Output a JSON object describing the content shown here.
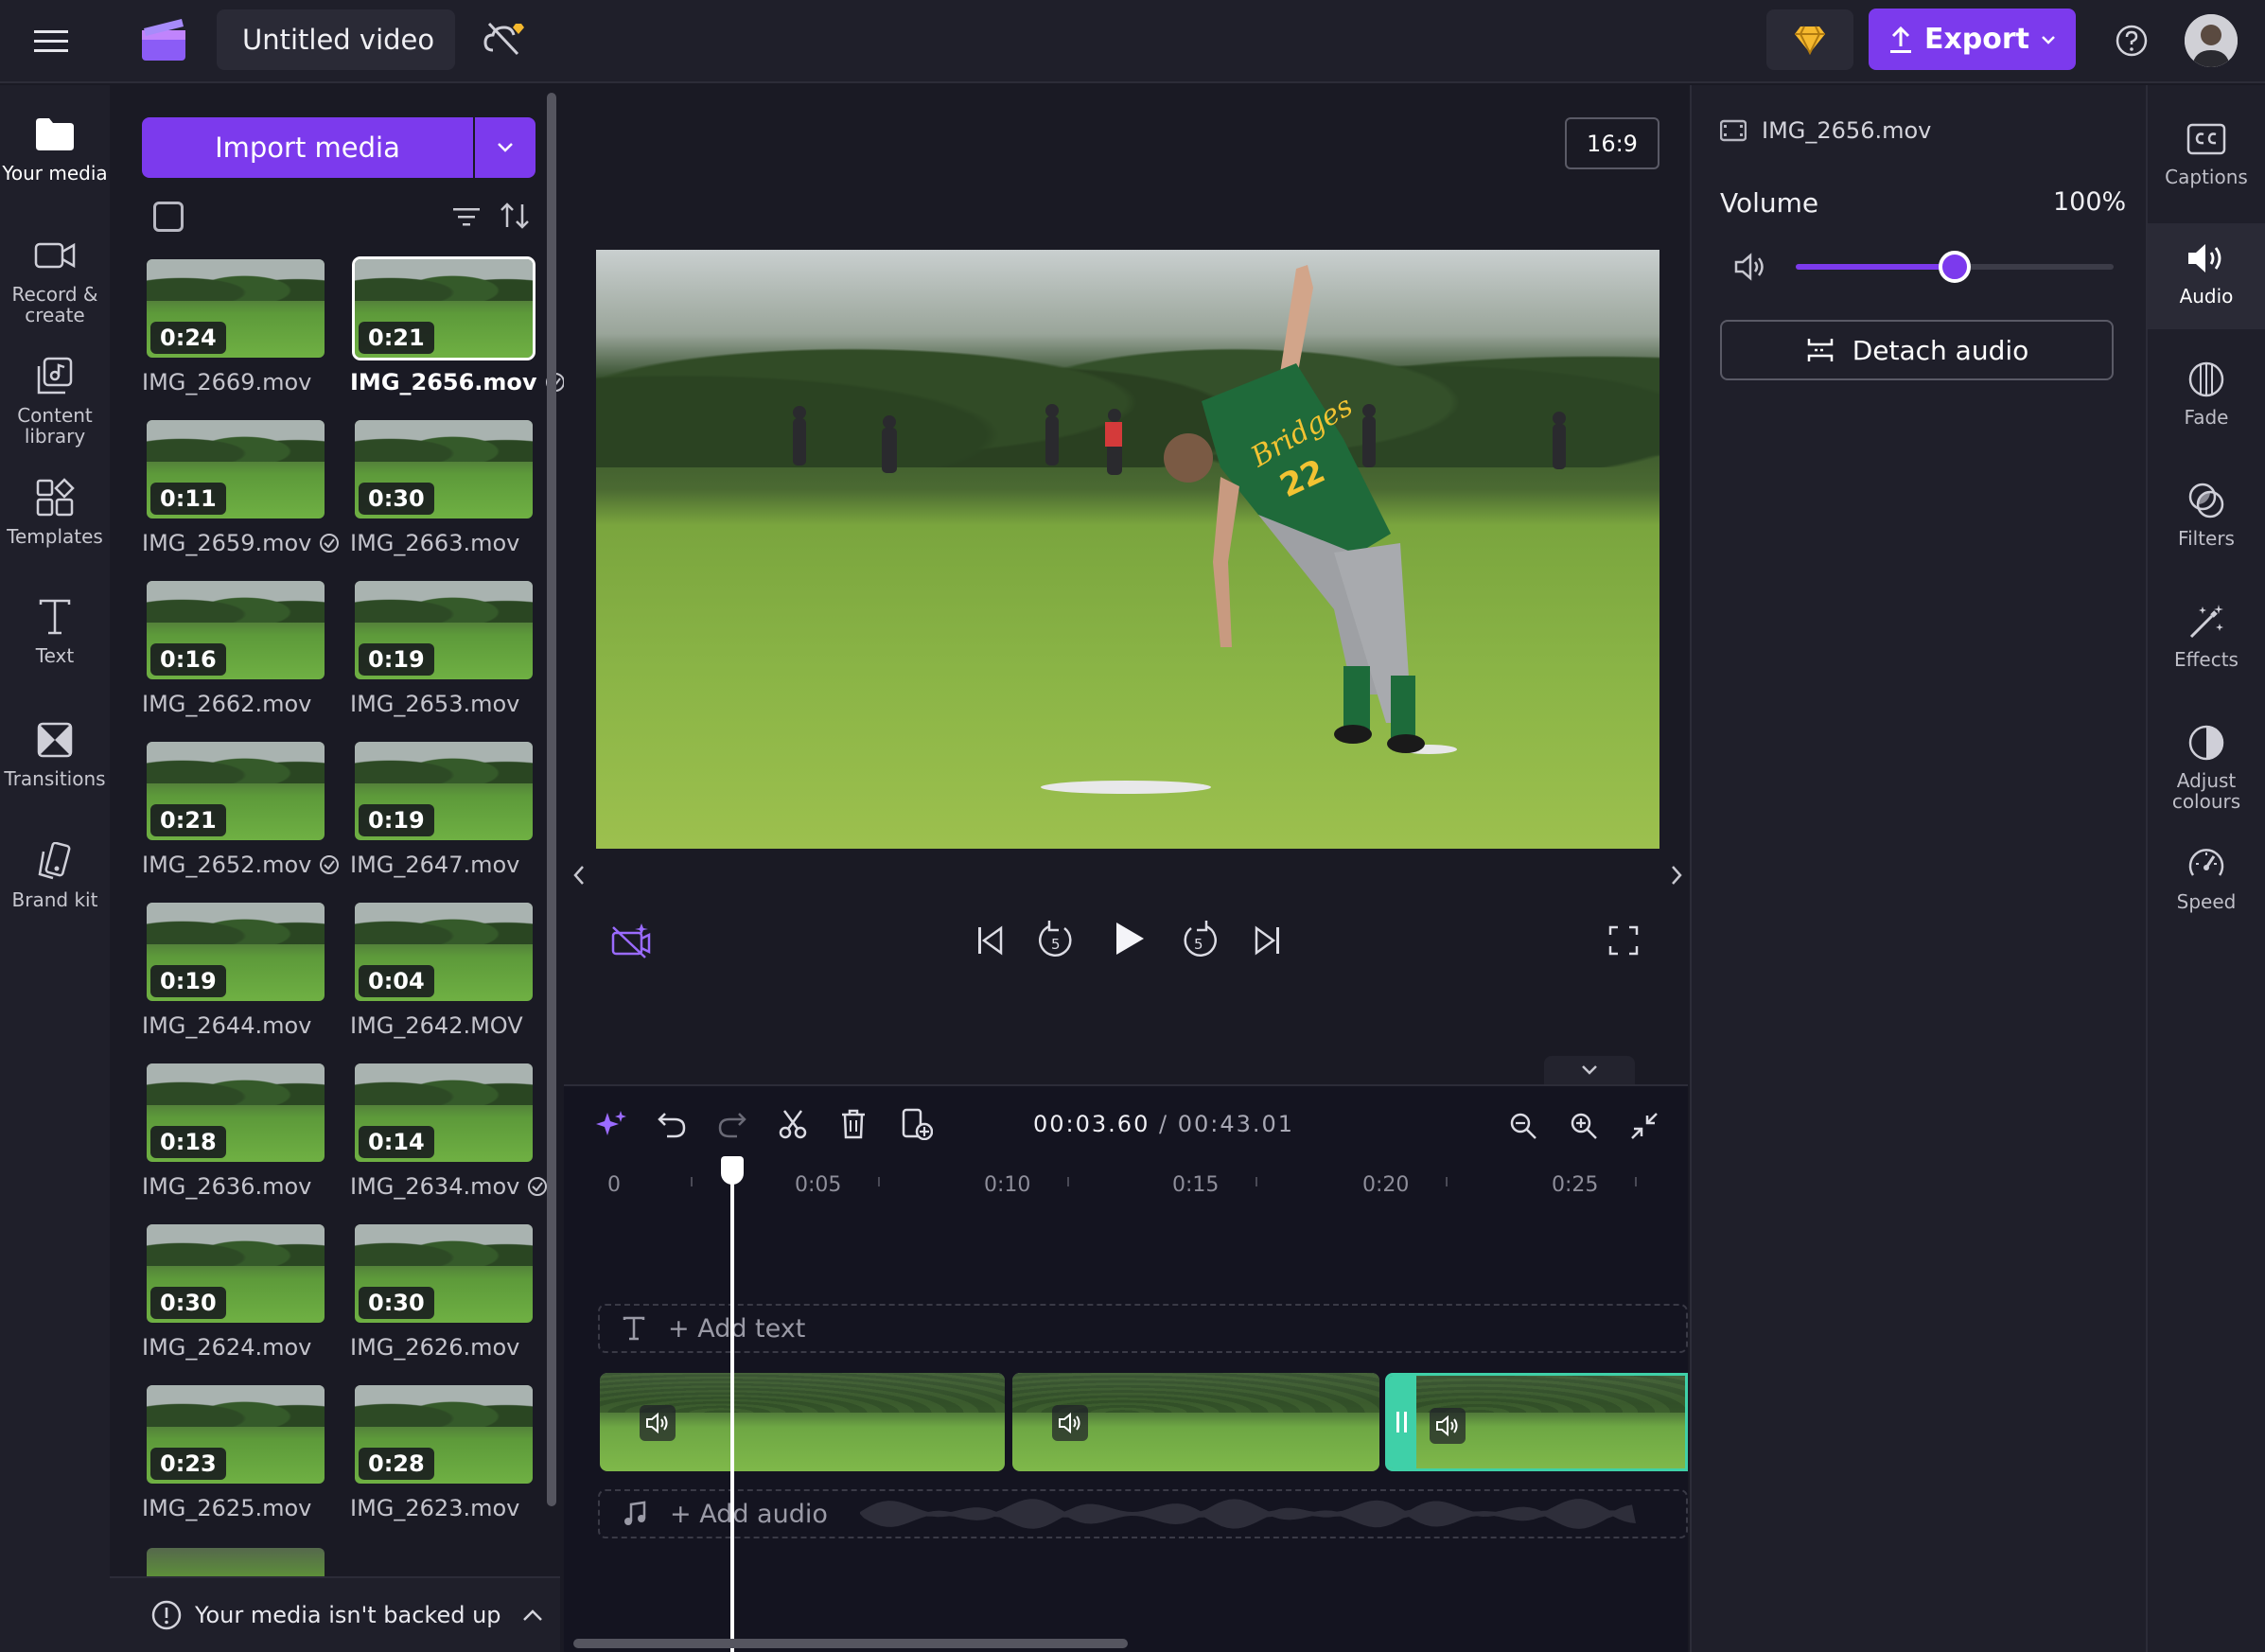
{
  "header": {
    "menu_icon": "hamburger-menu-icon",
    "logo": "clipchamp-logo",
    "project_title": "Untitled video",
    "sync_icon": "cloud-off-premium-icon",
    "premium_icon": "diamond-icon",
    "export_label": "Export",
    "help_icon": "help-icon"
  },
  "left_nav": [
    {
      "label": "Your media",
      "icon": "folder-icon",
      "active": true
    },
    {
      "label": "Record & create",
      "icon": "camera-icon"
    },
    {
      "label": "Content library",
      "icon": "library-icon"
    },
    {
      "label": "Templates",
      "icon": "templates-icon"
    },
    {
      "label": "Text",
      "icon": "text-icon"
    },
    {
      "label": "Transitions",
      "icon": "transitions-icon"
    },
    {
      "label": "Brand kit",
      "icon": "brand-kit-icon"
    }
  ],
  "media": {
    "import_label": "Import media",
    "items": [
      {
        "duration": "0:24",
        "name": "IMG_2669.mov",
        "used": false
      },
      {
        "duration": "0:21",
        "name": "IMG_2656.mov",
        "used": true,
        "selected": true
      },
      {
        "duration": "0:11",
        "name": "IMG_2659.mov",
        "used": true
      },
      {
        "duration": "0:30",
        "name": "IMG_2663.mov",
        "used": false
      },
      {
        "duration": "0:16",
        "name": "IMG_2662.mov",
        "used": false
      },
      {
        "duration": "0:19",
        "name": "IMG_2653.mov",
        "used": false
      },
      {
        "duration": "0:21",
        "name": "IMG_2652.mov",
        "used": true
      },
      {
        "duration": "0:19",
        "name": "IMG_2647.mov",
        "used": false
      },
      {
        "duration": "0:19",
        "name": "IMG_2644.mov",
        "used": false
      },
      {
        "duration": "0:04",
        "name": "IMG_2642.MOV",
        "used": false
      },
      {
        "duration": "0:18",
        "name": "IMG_2636.mov",
        "used": false
      },
      {
        "duration": "0:14",
        "name": "IMG_2634.mov",
        "used": true
      },
      {
        "duration": "0:30",
        "name": "IMG_2624.mov",
        "used": false
      },
      {
        "duration": "0:30",
        "name": "IMG_2626.mov",
        "used": false
      },
      {
        "duration": "0:23",
        "name": "IMG_2625.mov",
        "used": false
      },
      {
        "duration": "0:28",
        "name": "IMG_2623.mov",
        "used": false
      }
    ],
    "backup_notice": "Your media isn't backed up"
  },
  "preview": {
    "aspect_ratio": "16:9"
  },
  "timeline": {
    "current_time": "00:03.60",
    "total_time": "/ 00:43.01",
    "ticks": [
      "0",
      "0:05",
      "0:10",
      "0:15",
      "0:20",
      "0:25"
    ],
    "add_text_label": "+ Add text",
    "add_audio_label": "+ Add audio"
  },
  "properties": {
    "file_name": "IMG_2656.mov",
    "volume_label": "Volume",
    "volume_value": "100%",
    "volume_level": 0.5,
    "detach_label": "Detach audio"
  },
  "right_nav": [
    {
      "label": "Captions",
      "icon": "captions-icon"
    },
    {
      "label": "Audio",
      "icon": "speaker-icon",
      "active": true
    },
    {
      "label": "Fade",
      "icon": "fade-icon"
    },
    {
      "label": "Filters",
      "icon": "filters-icon"
    },
    {
      "label": "Effects",
      "icon": "magic-wand-icon"
    },
    {
      "label": "Adjust colours",
      "icon": "adjust-colours-icon"
    },
    {
      "label": "Speed",
      "icon": "speedometer-icon"
    }
  ],
  "colors": {
    "accent": "#7c3aed",
    "selected_clip_border": "#3fd0a8",
    "background": "#1a1a24"
  }
}
